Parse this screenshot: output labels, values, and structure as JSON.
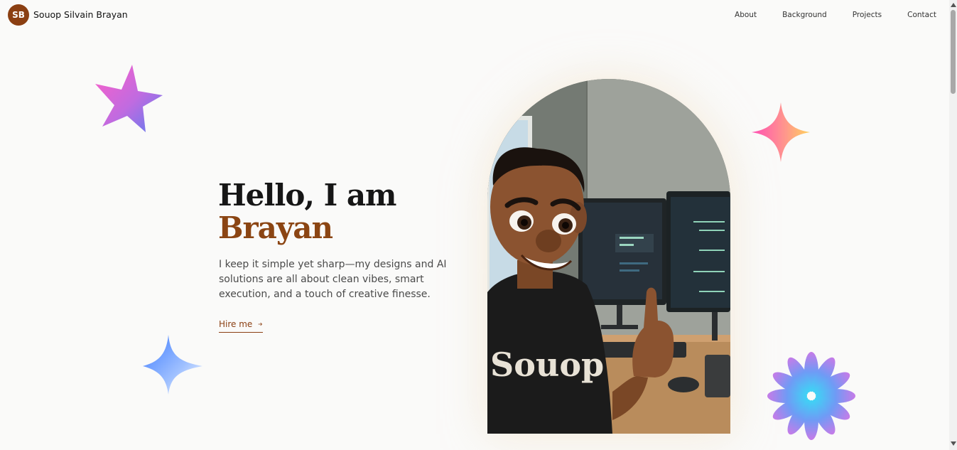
{
  "header": {
    "logo_initials": "SB",
    "brand_name": "Souop Silvain Brayan",
    "nav": [
      {
        "label": "About"
      },
      {
        "label": "Background"
      },
      {
        "label": "Projects"
      },
      {
        "label": "Contact"
      }
    ]
  },
  "hero": {
    "greeting": "Hello, I am",
    "name": "Brayan",
    "description": "I keep it simple yet sharp—my designs and AI solutions are all about clean vibes, smart execution, and a touch of creative finesse.",
    "cta_label": "Hire me",
    "cta_icon": "arrow-right-icon"
  },
  "portrait": {
    "shirt_text": "Souop"
  },
  "colors": {
    "accent": "#8b4513",
    "background": "#fafaf9",
    "text": "#161616"
  }
}
